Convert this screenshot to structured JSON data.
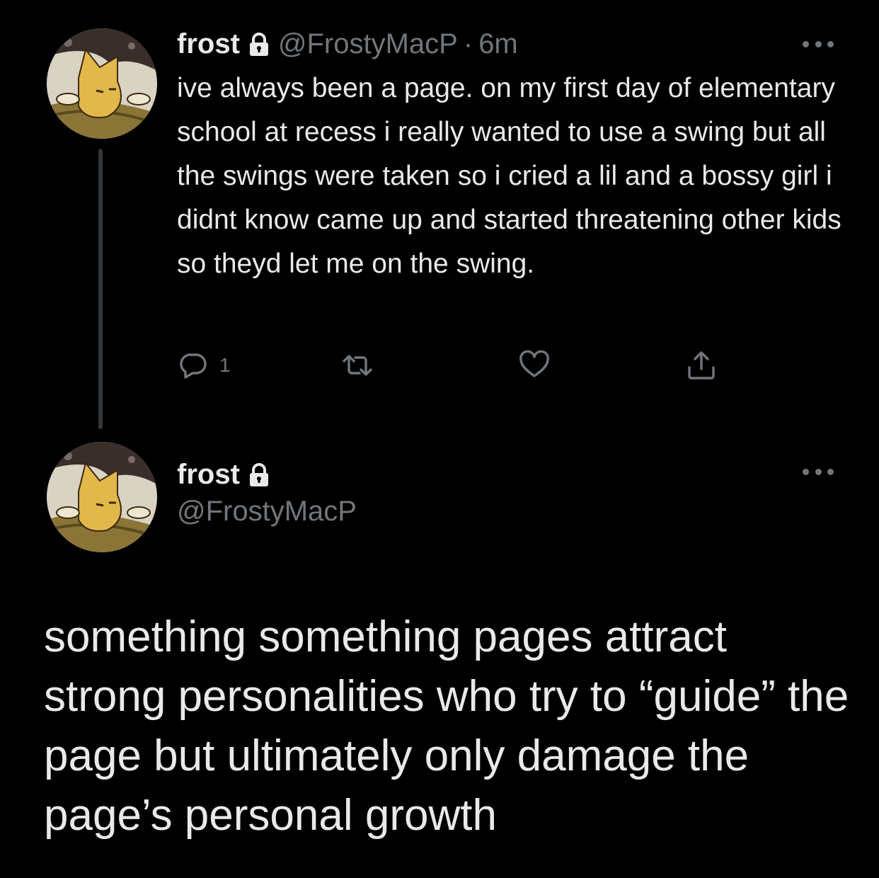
{
  "tweets": [
    {
      "display_name": "frost",
      "handle": "@FrostyMacP",
      "separator": "·",
      "time": "6m",
      "text": "ive always been a page. on my first day of elementary school at recess i really wanted to use a swing but all the swings were taken so i cried a lil and a bossy girl i didnt know came up and started threatening other kids so theyd let me on the swing.",
      "reply_count": "1"
    },
    {
      "display_name": "frost",
      "handle": "@FrostyMacP",
      "text": "something something pages attract strong personalities who try to “guide” the page but ultimately only damage the page’s personal growth"
    }
  ],
  "icons": [
    "lock-icon",
    "more-icon",
    "reply-icon",
    "retweet-icon",
    "like-icon",
    "share-icon"
  ],
  "colors": {
    "background": "#000000",
    "text": "#e7e9ea",
    "muted": "#71767b",
    "thread_line": "#333639",
    "avatar_accent": "#e3b84a"
  }
}
